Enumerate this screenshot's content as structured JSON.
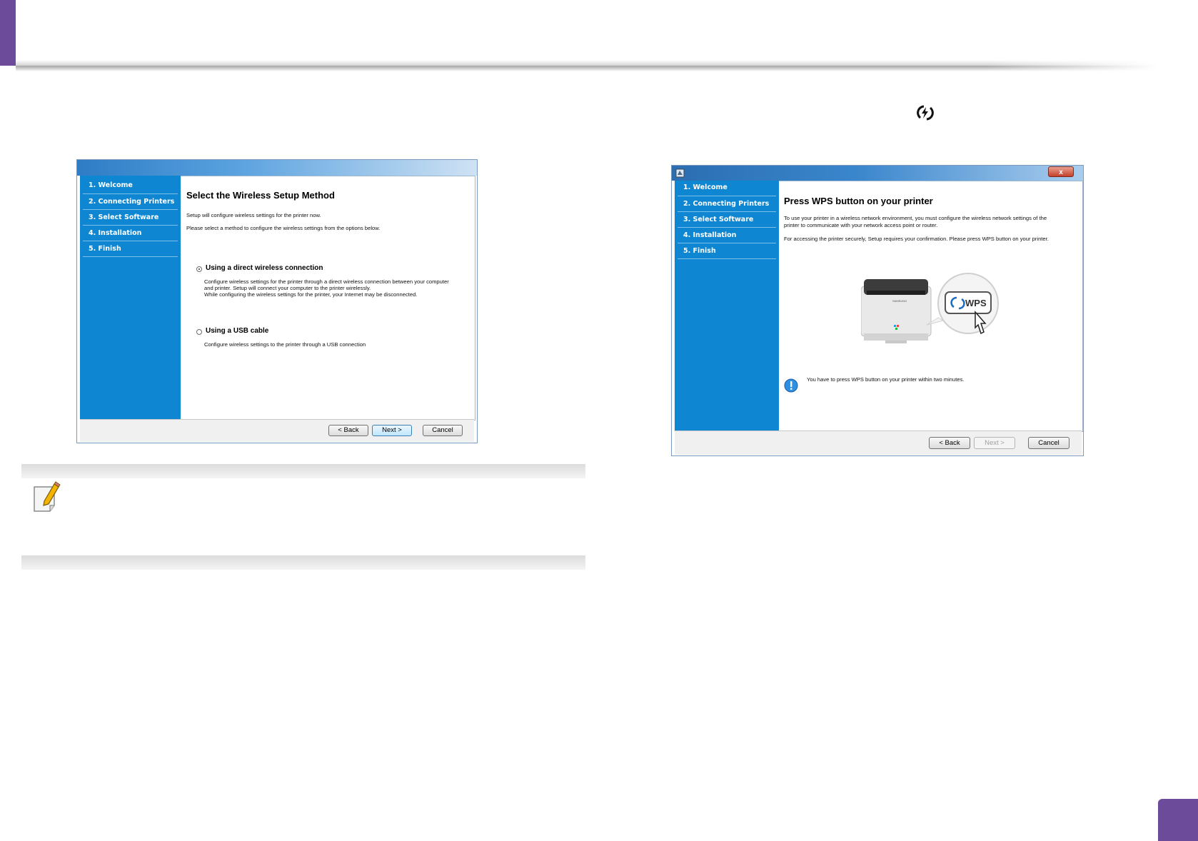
{
  "page": {
    "accent": "#6b4b9a",
    "sidebar_blue": "#0e86d1"
  },
  "dialog1": {
    "sidebar": [
      "1. Welcome",
      "2. Connecting Printers",
      "3. Select Software",
      "4. Installation",
      "5. Finish"
    ],
    "heading": "Select the Wireless Setup Method",
    "line1": "Setup will configure wireless settings for the printer now.",
    "line2": "Please select a method to configure the wireless settings from the options below.",
    "option1": {
      "title": "Using a direct wireless connection",
      "desc1": "Configure wireless settings for the printer through a direct wireless connection between your computer",
      "desc2": "and printer. Setup will connect your computer to the printer wirelessly.",
      "desc3": "While configuring the wireless settings for the printer, your Internet may be disconnected.",
      "selected": true
    },
    "option2": {
      "title": "Using a USB cable",
      "desc1": "Configure wireless settings to the printer through a USB connection",
      "selected": false
    },
    "buttons": {
      "back": "< Back",
      "next": "Next >",
      "cancel": "Cancel"
    }
  },
  "dialog2": {
    "close": "x",
    "sidebar": [
      "1. Welcome",
      "2. Connecting Printers",
      "3. Select Software",
      "4. Installation",
      "5. Finish"
    ],
    "heading": "Press WPS button on your printer",
    "line1a": "To use your printer in a wireless network environment, you must configure the wireless network settings of the",
    "line1b": "printer to communicate with your network access point or router.",
    "line2": "For accessing the printer securely, Setup requires your confirmation. Please press WPS button on your printer.",
    "illustration": {
      "button_label": "WPS",
      "brand": "SAMSUNG"
    },
    "info": "You have to press WPS button on your printer within two minutes.",
    "buttons": {
      "back": "< Back",
      "next": "Next >",
      "cancel": "Cancel"
    }
  },
  "icons": {
    "wps_glyph": "wps-icon",
    "note": "pencil-note-icon",
    "info": "info-icon"
  }
}
